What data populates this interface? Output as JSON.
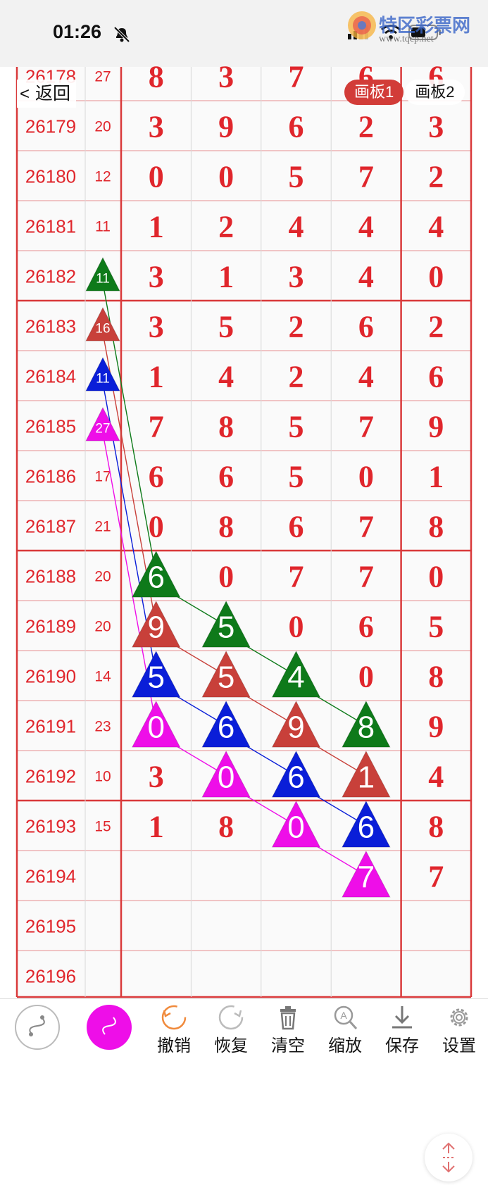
{
  "status": {
    "time": "01:26"
  },
  "header": {
    "back_label": "返回",
    "tabs": [
      "画板1",
      "画板2"
    ],
    "active_tab": 0
  },
  "watermark": {
    "title": "特区彩票网",
    "url": "www.tqcp.net"
  },
  "colors": {
    "grid": "#d9393a",
    "digit": "#e0262c",
    "green": "#0e7a1a",
    "red": "#c8403a",
    "blue": "#0a1ed8",
    "magenta": "#ee0ee8"
  },
  "rows": [
    {
      "issue": "26178",
      "sum": "27",
      "digits": [
        "8",
        "3",
        "7",
        "6",
        "6"
      ]
    },
    {
      "issue": "26179",
      "sum": "20",
      "digits": [
        "3",
        "9",
        "6",
        "2",
        "3"
      ]
    },
    {
      "issue": "26180",
      "sum": "12",
      "digits": [
        "0",
        "0",
        "5",
        "7",
        "2"
      ]
    },
    {
      "issue": "26181",
      "sum": "11",
      "digits": [
        "1",
        "2",
        "4",
        "4",
        "4"
      ]
    },
    {
      "issue": "26182",
      "sum": "11",
      "digits": [
        "3",
        "1",
        "3",
        "4",
        "0"
      ]
    },
    {
      "issue": "26183",
      "sum": "16",
      "digits": [
        "3",
        "5",
        "2",
        "6",
        "2"
      ]
    },
    {
      "issue": "26184",
      "sum": "11",
      "digits": [
        "1",
        "4",
        "2",
        "4",
        "6"
      ]
    },
    {
      "issue": "26185",
      "sum": "27",
      "digits": [
        "7",
        "8",
        "5",
        "7",
        "9"
      ]
    },
    {
      "issue": "26186",
      "sum": "17",
      "digits": [
        "6",
        "6",
        "5",
        "0",
        "1"
      ]
    },
    {
      "issue": "26187",
      "sum": "21",
      "digits": [
        "0",
        "8",
        "6",
        "7",
        "8"
      ]
    },
    {
      "issue": "26188",
      "sum": "20",
      "digits": [
        "6",
        "0",
        "7",
        "7",
        "0"
      ]
    },
    {
      "issue": "26189",
      "sum": "20",
      "digits": [
        "9",
        "5",
        "0",
        "6",
        "5"
      ]
    },
    {
      "issue": "26190",
      "sum": "14",
      "digits": [
        "5",
        "5",
        "4",
        "0",
        "8"
      ]
    },
    {
      "issue": "26191",
      "sum": "23",
      "digits": [
        "0",
        "6",
        "9",
        "8",
        "9"
      ]
    },
    {
      "issue": "26192",
      "sum": "10",
      "digits": [
        "3",
        "0",
        "6",
        "1",
        "4"
      ]
    },
    {
      "issue": "26193",
      "sum": "15",
      "digits": [
        "1",
        "8",
        "0",
        "6",
        "8"
      ]
    },
    {
      "issue": "26194",
      "sum": "",
      "digits": [
        "",
        "",
        "",
        "",
        "7"
      ]
    },
    {
      "issue": "26195",
      "sum": "",
      "digits": [
        "",
        "",
        "",
        "",
        ""
      ]
    },
    {
      "issue": "26196",
      "sum": "",
      "digits": [
        "",
        "",
        "",
        "",
        ""
      ]
    }
  ],
  "marks": [
    {
      "row": 4,
      "col": 0,
      "color": "green",
      "label": "11"
    },
    {
      "row": 5,
      "col": 0,
      "color": "red",
      "label": "16"
    },
    {
      "row": 6,
      "col": 0,
      "color": "blue",
      "label": "11"
    },
    {
      "row": 7,
      "col": 0,
      "color": "magenta",
      "label": "27"
    },
    {
      "row": 10,
      "col": 1,
      "color": "green",
      "label": "6"
    },
    {
      "row": 11,
      "col": 2,
      "color": "green",
      "label": "5"
    },
    {
      "row": 12,
      "col": 3,
      "color": "green",
      "label": "4"
    },
    {
      "row": 13,
      "col": 4,
      "color": "green",
      "label": "8"
    },
    {
      "row": 11,
      "col": 1,
      "color": "red",
      "label": "9"
    },
    {
      "row": 12,
      "col": 2,
      "color": "red",
      "label": "5"
    },
    {
      "row": 13,
      "col": 3,
      "color": "red",
      "label": "9"
    },
    {
      "row": 14,
      "col": 4,
      "color": "red",
      "label": "1"
    },
    {
      "row": 12,
      "col": 1,
      "color": "blue",
      "label": "5"
    },
    {
      "row": 13,
      "col": 2,
      "color": "blue",
      "label": "6"
    },
    {
      "row": 14,
      "col": 3,
      "color": "blue",
      "label": "6"
    },
    {
      "row": 15,
      "col": 4,
      "color": "blue",
      "label": "6"
    },
    {
      "row": 13,
      "col": 1,
      "color": "magenta",
      "label": "0"
    },
    {
      "row": 14,
      "col": 2,
      "color": "magenta",
      "label": "0"
    },
    {
      "row": 15,
      "col": 3,
      "color": "magenta",
      "label": "0"
    },
    {
      "row": 16,
      "col": 4,
      "color": "magenta",
      "label": "7"
    }
  ],
  "toolbar": {
    "undo": "撤销",
    "redo": "恢复",
    "clear": "清空",
    "zoom": "缩放",
    "save": "保存",
    "settings": "设置"
  }
}
